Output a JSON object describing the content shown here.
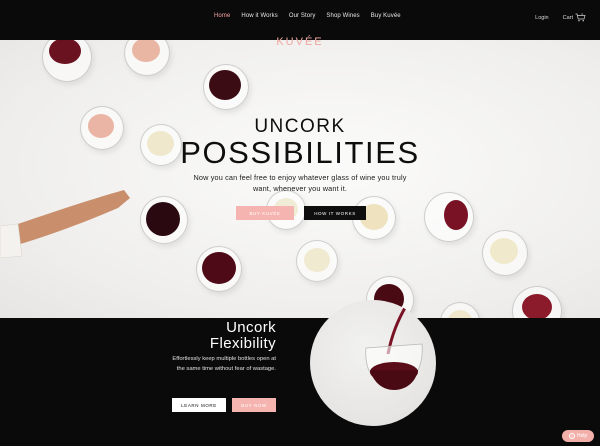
{
  "nav": {
    "links": [
      {
        "label": "Home",
        "active": true
      },
      {
        "label": "How it Works",
        "active": false
      },
      {
        "label": "Our Story",
        "active": false
      },
      {
        "label": "Shop Wines",
        "active": false
      },
      {
        "label": "Buy Kuvée",
        "active": false
      }
    ],
    "login": "Login",
    "cart": "Cart",
    "cart_count": "0"
  },
  "brand": "KUVÉE",
  "hero": {
    "eyebrow": "UNCORK",
    "title": "POSSIBILITIES",
    "subtitle": "Now you can feel free to enjoy whatever glass of wine you truly want, whenever you want it.",
    "buy_button": "BUY KUVÉE",
    "how_button": "HOW IT WORKS"
  },
  "section2": {
    "title_line1": "Uncork",
    "title_line2": "Flexibility",
    "text": "Effortlessly keep multiple bottles open at the same time without fear of wastage.",
    "learn_button": "LEARN MORE",
    "buy_button": "BUY NOW"
  },
  "help": "Help",
  "colors": {
    "accent_pink": "#f5b4af",
    "dark": "#0b0a0b",
    "nav_active": "#f3a6a2"
  }
}
